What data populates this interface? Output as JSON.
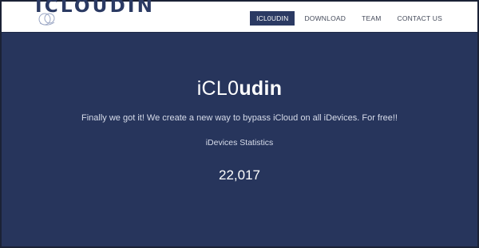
{
  "navbar": {
    "logo_text": "ICLOUDIN",
    "items": [
      {
        "label": "ICL0UDIN",
        "active": true
      },
      {
        "label": "DOWNLOAD",
        "active": false
      },
      {
        "label": "TEAM",
        "active": false
      },
      {
        "label": "CONTACT US",
        "active": false
      }
    ]
  },
  "hero": {
    "title_light": "iCL0",
    "title_bold": "udin",
    "tagline": "Finally we got it! We create a new way to bypass iCloud on all iDevices. For free!!",
    "stats_label": "iDevices Statistics",
    "stats_value": "22,017"
  },
  "colors": {
    "background": "#27355c",
    "brand": "#2b3a63",
    "navbar": "#ffffff"
  },
  "icons": [
    "cloud-icon"
  ]
}
